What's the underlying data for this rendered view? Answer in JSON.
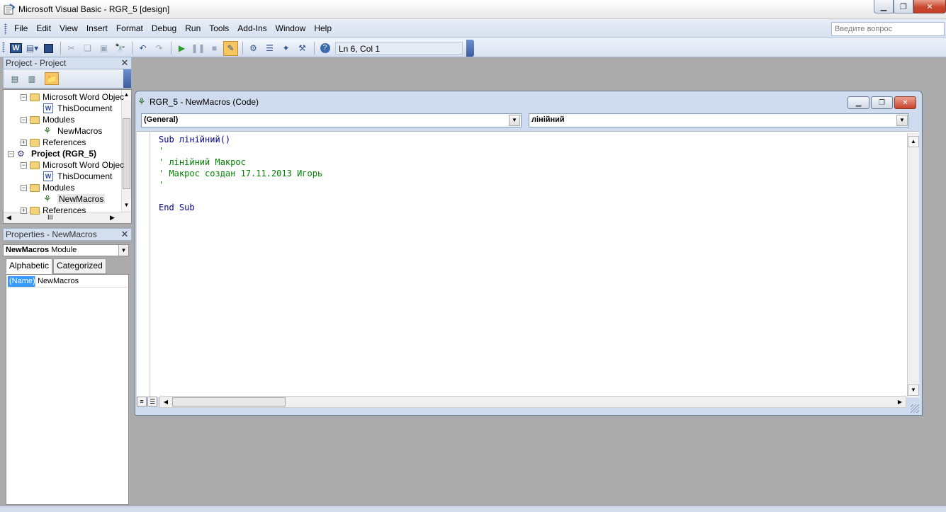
{
  "window": {
    "title": "Microsoft Visual Basic - RGR_5 [design]",
    "buttons": [
      "minimize",
      "maximize",
      "close"
    ]
  },
  "menubar": {
    "items": [
      "File",
      "Edit",
      "View",
      "Insert",
      "Format",
      "Debug",
      "Run",
      "Tools",
      "Add-Ins",
      "Window",
      "Help"
    ],
    "ask_placeholder": "Введите вопрос"
  },
  "toolbar": {
    "cursor_position": "Ln 6, Col 1",
    "icons": [
      "word-icon",
      "insert-module-icon",
      "save-icon",
      "cut-icon",
      "copy-icon",
      "paste-icon",
      "find-icon",
      "undo-icon",
      "redo-icon",
      "run-icon",
      "break-icon",
      "reset-icon",
      "design-mode-icon",
      "project-explorer-icon",
      "properties-icon",
      "object-browser-icon",
      "toolbox-icon",
      "help-icon"
    ]
  },
  "project_pane": {
    "title": "Project - Project",
    "tree": [
      {
        "label": "Microsoft Word Objec",
        "type": "folder",
        "level": 1,
        "expanded": true
      },
      {
        "label": "ThisDocument",
        "type": "doc",
        "level": 2
      },
      {
        "label": "Modules",
        "type": "folder",
        "level": 1,
        "expanded": true
      },
      {
        "label": "NewMacros",
        "type": "module",
        "level": 2
      },
      {
        "label": "References",
        "type": "folder",
        "level": 1,
        "expanded": false
      },
      {
        "label": "Project (RGR_5)",
        "type": "project",
        "level": 0,
        "expanded": true
      },
      {
        "label": "Microsoft Word Objec",
        "type": "folder",
        "level": 1,
        "expanded": true
      },
      {
        "label": "ThisDocument",
        "type": "doc",
        "level": 2
      },
      {
        "label": "Modules",
        "type": "folder",
        "level": 1,
        "expanded": true
      },
      {
        "label": "NewMacros",
        "type": "module",
        "level": 2,
        "selected": true
      },
      {
        "label": "References",
        "type": "folder",
        "level": 1,
        "expanded": false
      }
    ],
    "hscroll_label": "III"
  },
  "properties_pane": {
    "title": "Properties - NewMacros",
    "object_name": "NewMacros",
    "object_type": "Module",
    "tabs": [
      "Alphabetic",
      "Categorized"
    ],
    "rows": [
      {
        "name": "(Name)",
        "value": "NewMacros"
      }
    ]
  },
  "code_window": {
    "title": "RGR_5 - NewMacros (Code)",
    "object_combo": "(General)",
    "procedure_combo": "лінійний",
    "lines": [
      {
        "text": "Sub лінійний()",
        "kind": "kw"
      },
      {
        "text": "'",
        "kind": "cm"
      },
      {
        "text": "' лінійний Макрос",
        "kind": "cm"
      },
      {
        "text": "' Макрос создан 17.11.2013 Игорь",
        "kind": "cm"
      },
      {
        "text": "'",
        "kind": "cm"
      },
      {
        "text": "",
        "kind": "plain"
      },
      {
        "text": "End Sub",
        "kind": "kw"
      }
    ]
  },
  "colors": {
    "workspace": "#ababab",
    "keyword": "#00008b",
    "comment": "#008000",
    "selection": "#3399ff"
  }
}
